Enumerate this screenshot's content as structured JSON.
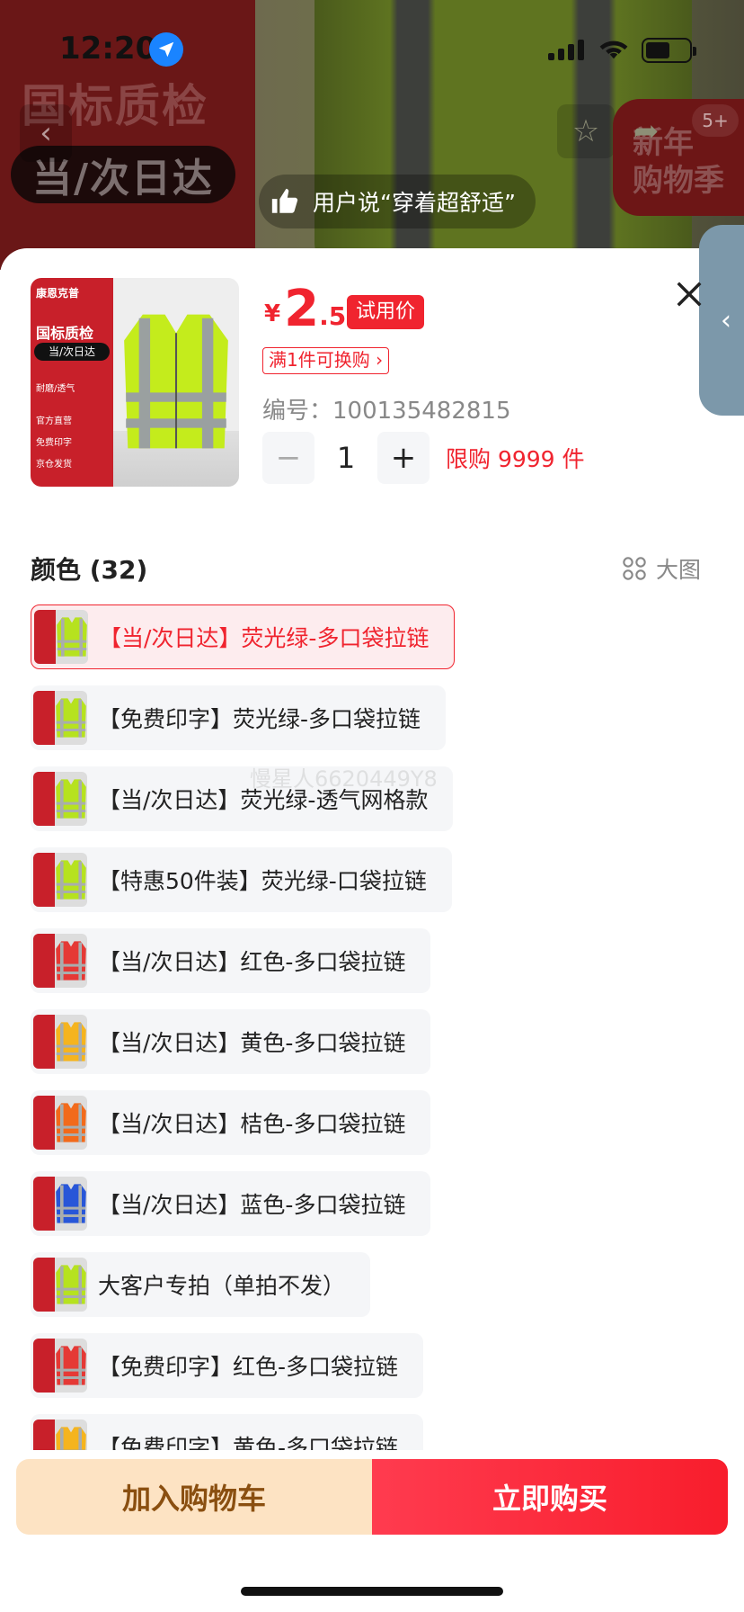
{
  "status_bar": {
    "time": "12:20"
  },
  "background": {
    "left_title": "国标质检",
    "left_pill": "当/次日达",
    "badge_count": "5+",
    "promo": [
      "新年",
      "购物季"
    ],
    "review_text": "用户说“穿着超舒适”"
  },
  "thumbnail": {
    "brand": "康恩克普",
    "title": "国标质检",
    "pill": "当/次日达",
    "tag": "耐磨/透气",
    "features": [
      "官方直营",
      "免费印字",
      "京仓发货"
    ]
  },
  "product": {
    "currency": "¥",
    "price_int": "2",
    "price_dec": ".5",
    "trial_label": "试用价",
    "swap_label": "满1件可换购",
    "sku_label": "编号：",
    "sku_value": "100135482815",
    "qty": "1",
    "limit": "限购 9999 件"
  },
  "color_section": {
    "title": "颜色 (32)",
    "big_image_label": "大图",
    "options": [
      {
        "label": "【当/次日达】荧光绿-多口袋拉链",
        "vest": "#b6e21f",
        "selected": true
      },
      {
        "label": "【免费印字】荧光绿-多口袋拉链",
        "vest": "#b6e21f",
        "selected": false
      },
      {
        "label": "【当/次日达】荧光绿-透气网格款",
        "vest": "#b6e21f",
        "selected": false
      },
      {
        "label": "【特惠50件装】荧光绿-口袋拉链",
        "vest": "#b6e21f",
        "selected": false
      },
      {
        "label": "【当/次日达】红色-多口袋拉链",
        "vest": "#e53935",
        "selected": false
      },
      {
        "label": "【当/次日达】黄色-多口袋拉链",
        "vest": "#f5b41e",
        "selected": false
      },
      {
        "label": "【当/次日达】桔色-多口袋拉链",
        "vest": "#f26a1b",
        "selected": false
      },
      {
        "label": "【当/次日达】蓝色-多口袋拉链",
        "vest": "#2856d8",
        "selected": false
      },
      {
        "label": "大客户专拍（单拍不发）",
        "vest": "#b6e21f",
        "selected": false
      },
      {
        "label": "【免费印字】红色-多口袋拉链",
        "vest": "#e53935",
        "selected": false
      },
      {
        "label": "【免费印字】黄色-多口袋拉链",
        "vest": "#f5b41e",
        "selected": false
      }
    ]
  },
  "watermark": "慢星人6620449Y8",
  "actions": {
    "add_to_cart": "加入购物车",
    "buy_now": "立即购买"
  },
  "colors": {
    "accent": "#f0242f",
    "cart_bg": "#fde3c3",
    "cart_text": "#8a4f10"
  }
}
